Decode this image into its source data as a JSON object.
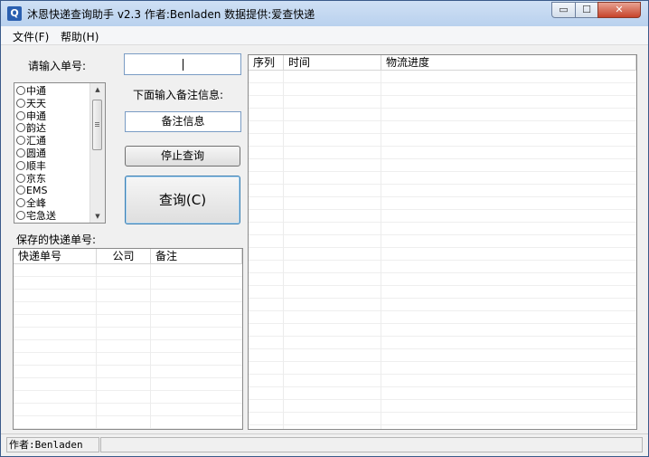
{
  "window": {
    "title": "沐恩快递查询助手 v2.3  作者:Benladen 数据提供:爱查快递",
    "icon": "magnifier-app-icon"
  },
  "controls": {
    "minimize": "▭",
    "maximize": "☐",
    "close": "✕"
  },
  "menu": {
    "file": "文件(F)",
    "help": "帮助(H)"
  },
  "form": {
    "tracking_label": "请输入单号:",
    "tracking_value": "",
    "note_label": "下面输入备注信息:",
    "note_value": "备注信息",
    "stop_button": "停止查询",
    "query_button": "查询(C)"
  },
  "couriers": [
    "中通",
    "天天",
    "申通",
    "韵达",
    "汇通",
    "圆通",
    "顺丰",
    "京东",
    "EMS",
    "全峰",
    "宅急送"
  ],
  "saved": {
    "label": "保存的快递单号:",
    "columns": [
      "快递单号",
      "公司",
      "备注"
    ]
  },
  "results": {
    "columns": [
      "序列",
      "时间",
      "物流进度"
    ]
  },
  "status": {
    "author": "作者:Benladen",
    "pane2": ""
  },
  "colors": {
    "titlebar": "#b9d1ee",
    "border": "#3a5a8a",
    "close": "#c7432a"
  }
}
